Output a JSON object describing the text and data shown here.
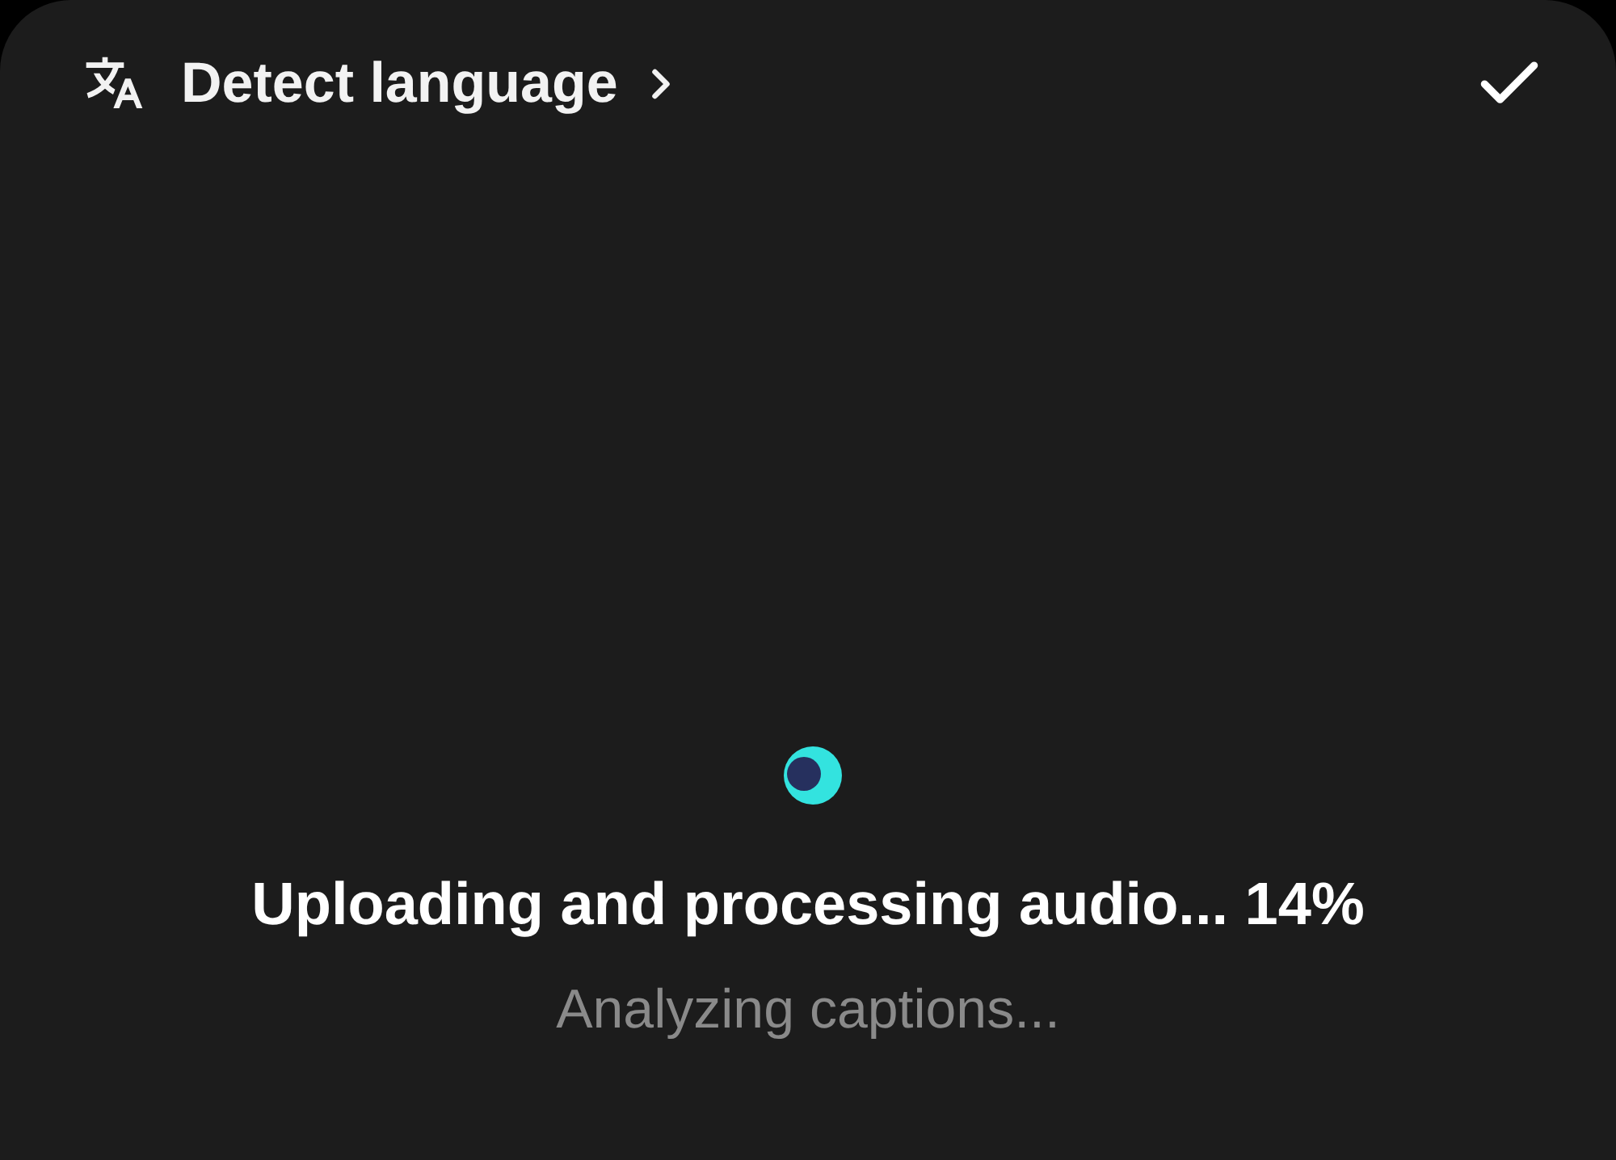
{
  "header": {
    "language_button": {
      "label": "Detect language"
    }
  },
  "status": {
    "title": "Uploading and processing audio... 14%",
    "subtitle": "Analyzing captions..."
  }
}
